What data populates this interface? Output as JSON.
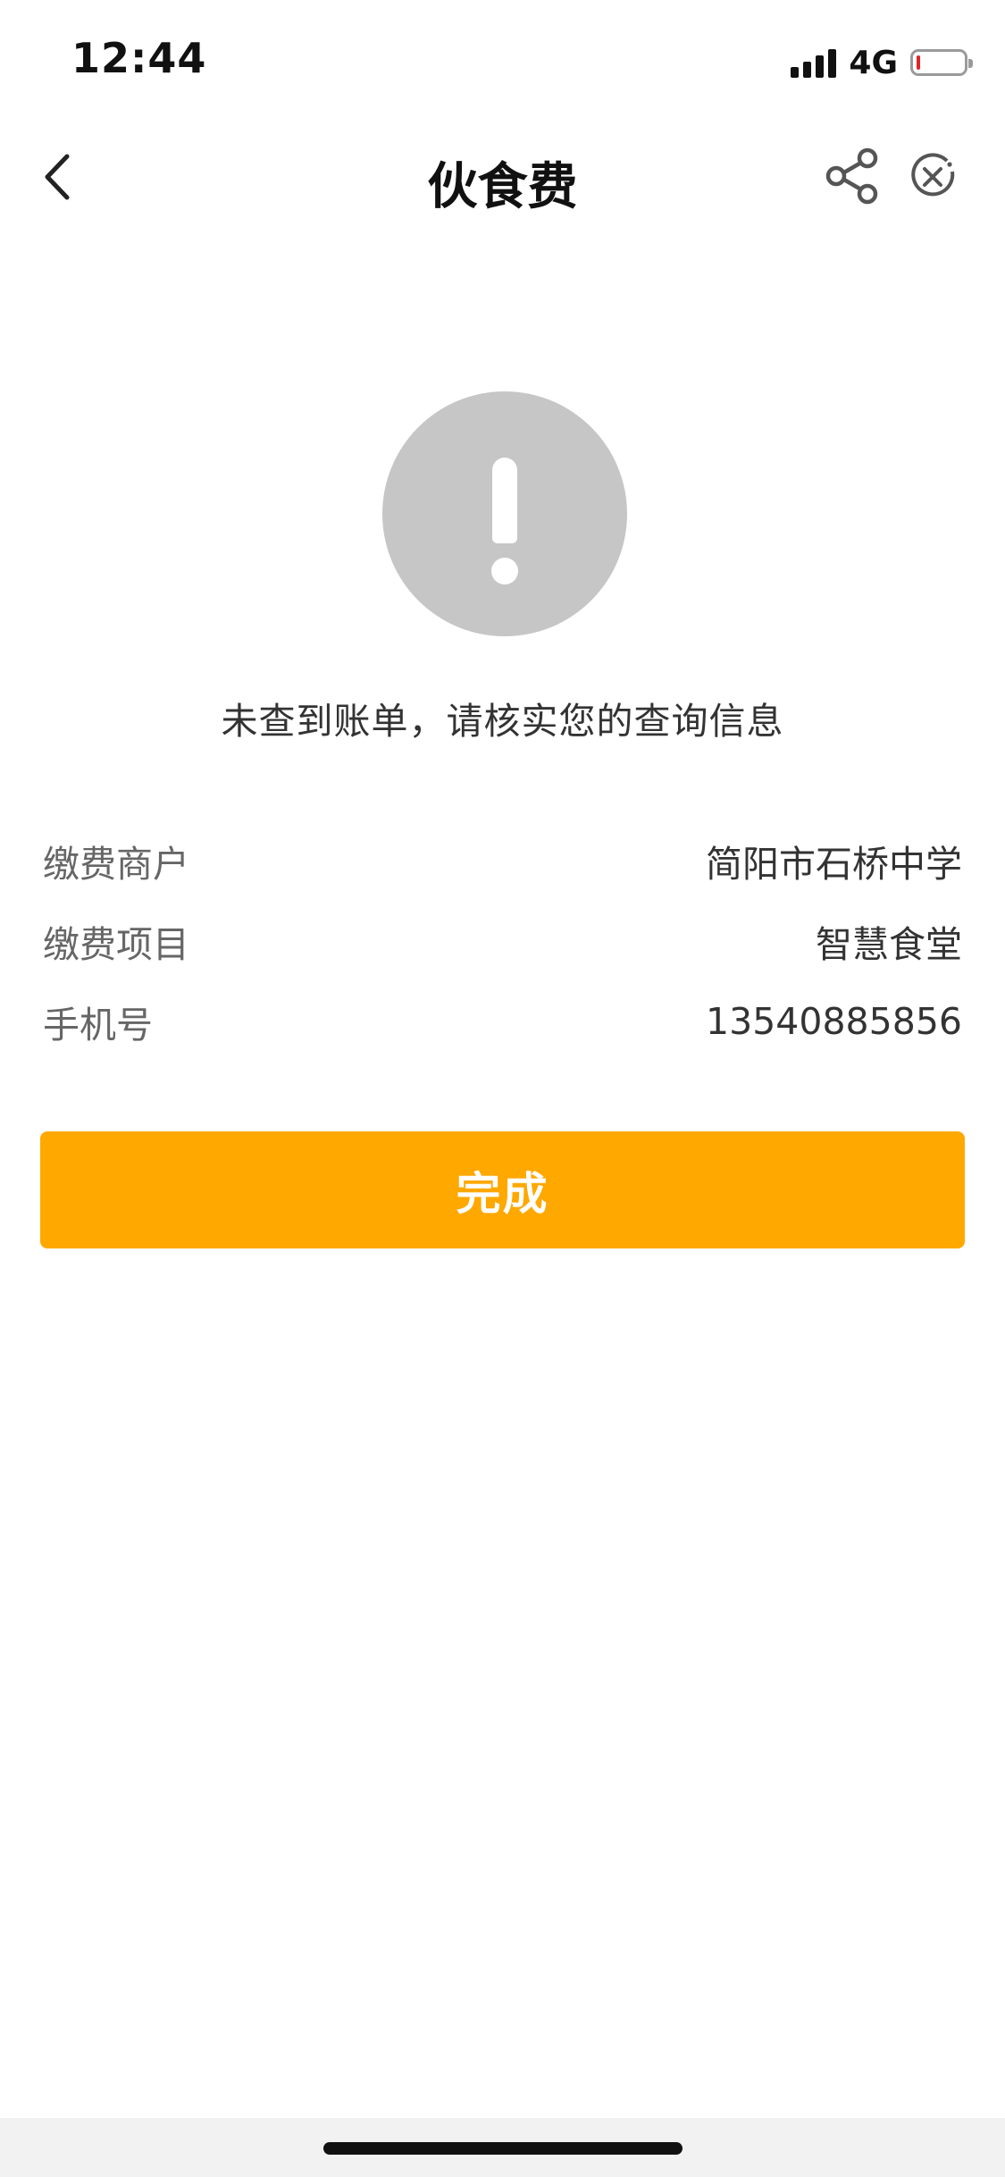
{
  "status_bar": {
    "time": "12:44",
    "network": "4G",
    "battery_level": 0.08,
    "battery_color": "#e0242a"
  },
  "nav": {
    "title": "伙食费",
    "back_icon": "chevron-left-icon",
    "share_icon": "share-icon",
    "close_icon": "close-circle-icon"
  },
  "result": {
    "icon": "exclamation-circle-icon",
    "message": "未查到账单，请核实您的查询信息"
  },
  "info": [
    {
      "label": "缴费商户",
      "value": "简阳市石桥中学"
    },
    {
      "label": "缴费项目",
      "value": "智慧食堂"
    },
    {
      "label": "手机号",
      "value": "13540885856"
    }
  ],
  "done_button": {
    "label": "完成",
    "color": "#ffa800"
  }
}
